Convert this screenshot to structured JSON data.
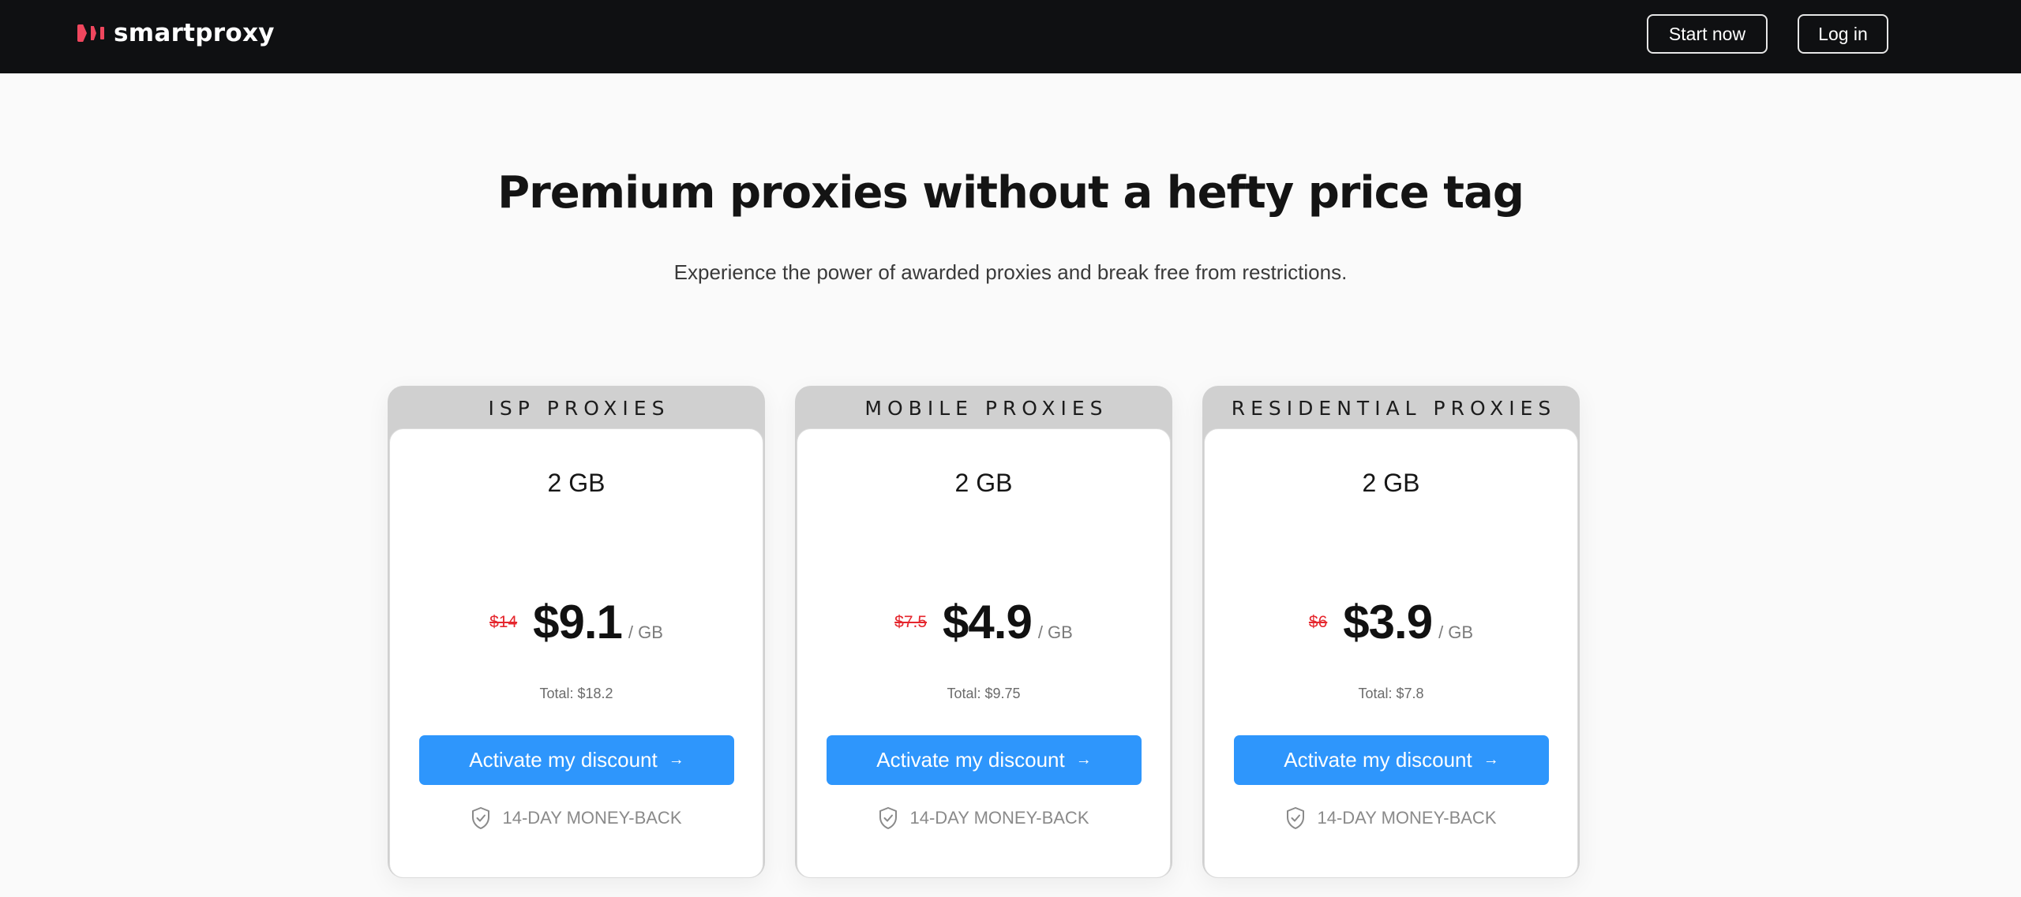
{
  "nav": {
    "brand": "smartproxy",
    "logo_icon": "smartproxy-logo-icon",
    "start_label": "Start now",
    "login_label": "Log in"
  },
  "hero": {
    "title": "Premium proxies without a hefty price tag",
    "subtitle": "Experience the power of awarded proxies and break free from restrictions."
  },
  "colors": {
    "nav_bg": "#0f1012",
    "accent": "#2e96fc",
    "old_price": "#e5262d",
    "card_header": "#d0d0d0"
  },
  "plans": [
    {
      "name": "ISP PROXIES",
      "size": "2 GB",
      "old_price": "$14",
      "price": "$9.1",
      "unit": "/ GB",
      "total": "Total: $18.2",
      "cta": "Activate my discount",
      "cta_icon": "arrow-right-icon",
      "guarantee": "14-DAY MONEY-BACK",
      "guarantee_icon": "shield-check-icon"
    },
    {
      "name": "MOBILE PROXIES",
      "size": "2 GB",
      "old_price": "$7.5",
      "price": "$4.9",
      "unit": "/ GB",
      "total": "Total: $9.75",
      "cta": "Activate my discount",
      "cta_icon": "arrow-right-icon",
      "guarantee": "14-DAY MONEY-BACK",
      "guarantee_icon": "shield-check-icon"
    },
    {
      "name": "RESIDENTIAL PROXIES",
      "size": "2 GB",
      "old_price": "$6",
      "price": "$3.9",
      "unit": "/ GB",
      "total": "Total: $7.8",
      "cta": "Activate my discount",
      "cta_icon": "arrow-right-icon",
      "guarantee": "14-DAY MONEY-BACK",
      "guarantee_icon": "shield-check-icon"
    }
  ]
}
